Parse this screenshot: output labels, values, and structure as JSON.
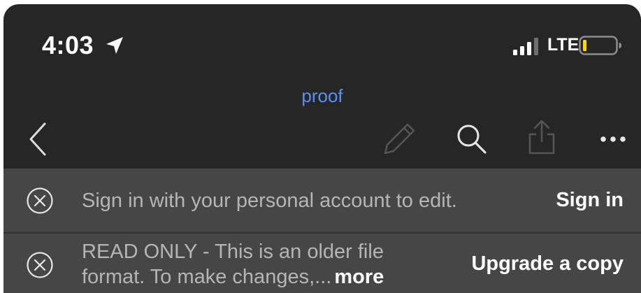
{
  "status_bar": {
    "time": "4:03",
    "network": "LTE",
    "location_icon": "location-arrow-icon",
    "signal_icon": "cellular-signal-icon",
    "battery_icon": "battery-low-icon",
    "battery_color": "#ffd60a"
  },
  "nav": {
    "title": "proof",
    "title_color": "#5b8ff0",
    "back_icon": "chevron-left-icon",
    "edit_icon": "pencil-icon",
    "search_icon": "search-icon",
    "share_icon": "share-icon",
    "more_icon": "ellipsis-icon"
  },
  "banners": [
    {
      "message": "Sign in with your personal account to edit.",
      "action": "Sign in"
    },
    {
      "message_line1": "READ ONLY - This is an older file",
      "message_line2": "format. To make changes,...",
      "more_label": "more",
      "action": "Upgrade a copy"
    }
  ]
}
